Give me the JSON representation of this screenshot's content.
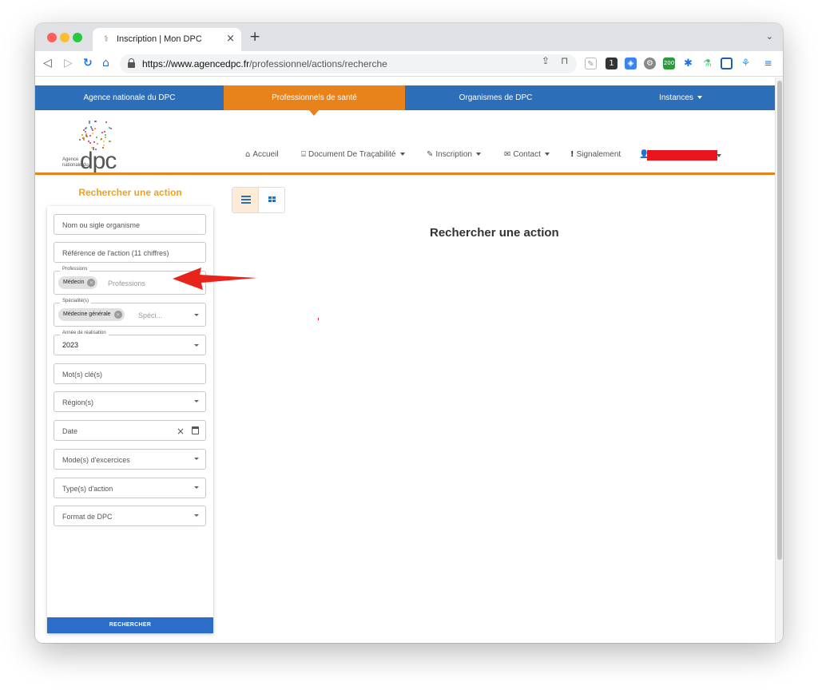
{
  "browser": {
    "tab_title": "Inscription | Mon DPC",
    "url_host": "https://www.agencedpc.fr",
    "url_path": "/professionnel/actions/recherche",
    "colors": {
      "tab_bar": "#dfe1e5",
      "accent": "#1a73e8"
    }
  },
  "topnav": {
    "items": [
      {
        "label": "Agence nationale du DPC",
        "active": false
      },
      {
        "label": "Professionnels de santé",
        "active": true
      },
      {
        "label": "Organismes de DPC",
        "active": false
      },
      {
        "label": "Instances",
        "active": false
      }
    ],
    "colors": {
      "background": "#2c6fb8",
      "active": "#e8821a"
    }
  },
  "logo": {
    "line1": "Agence",
    "line2": "nationale du",
    "wordmark": "dpc"
  },
  "mainnav": {
    "accueil": "Accueil",
    "document": "Document De Traçabilité",
    "inscription": "Inscription",
    "contact": "Contact",
    "signalement": "Signalement"
  },
  "search": {
    "title": "Rechercher une action",
    "fields": {
      "organisme_placeholder": "Nom ou sigle organisme",
      "reference_placeholder": "Référence de l'action (11 chiffres)",
      "professions_legend": "Professions",
      "professions_chip": "Médecin",
      "professions_placeholder": "Professions",
      "specialites_legend": "Spécialité(s)",
      "specialites_chip": "Médecine générale",
      "specialites_placeholder": "Spéci...",
      "annee_legend": "Année de réalisation",
      "annee_value": "2023",
      "motscles_placeholder": "Mot(s) clé(s)",
      "regions_placeholder": "Région(s)",
      "date_placeholder": "Date",
      "modes_placeholder": "Mode(s) d'excercices",
      "types_placeholder": "Type(s) d'action",
      "format_placeholder": "Format de DPC"
    },
    "button": "RECHERCHER",
    "colors": {
      "title": "#f0a020",
      "button": "#2d6cc9"
    }
  },
  "main": {
    "title": "Rechercher une action"
  }
}
